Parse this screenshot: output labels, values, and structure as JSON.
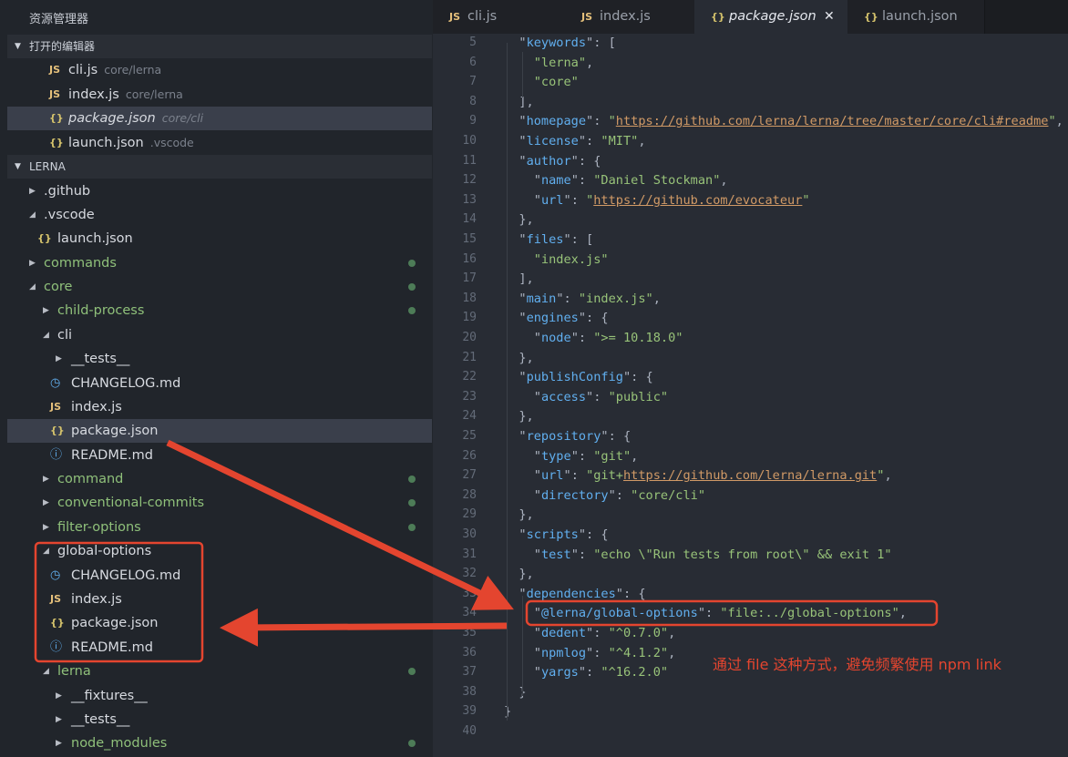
{
  "sidebar": {
    "title": "资源管理器",
    "open_editors": {
      "header": "打开的编辑器",
      "items": [
        {
          "icon": "js-file-icon",
          "icon_text": "JS",
          "name": "cli.js",
          "path": "core/lerna"
        },
        {
          "icon": "js-file-icon",
          "icon_text": "JS",
          "name": "index.js",
          "path": "core/lerna"
        },
        {
          "icon": "json-file-icon",
          "icon_text": "{}",
          "name": "package.json",
          "path": "core/cli",
          "selected": true
        },
        {
          "icon": "json-file-icon",
          "icon_text": "{}",
          "name": "launch.json",
          "path": ".vscode"
        }
      ]
    },
    "explorer": {
      "header": "LERNA",
      "tree": [
        {
          "label": ".github"
        },
        {
          "label": ".vscode"
        },
        {
          "label": "launch.json"
        },
        {
          "label": "commands"
        },
        {
          "label": "core"
        },
        {
          "label": "child-process"
        },
        {
          "label": "cli"
        },
        {
          "label": "__tests__"
        },
        {
          "label": "CHANGELOG.md"
        },
        {
          "label": "index.js"
        },
        {
          "label": "package.json"
        },
        {
          "label": "README.md"
        },
        {
          "label": "command"
        },
        {
          "label": "conventional-commits"
        },
        {
          "label": "filter-options"
        },
        {
          "label": "global-options"
        },
        {
          "label": "CHANGELOG.md"
        },
        {
          "label": "index.js"
        },
        {
          "label": "package.json"
        },
        {
          "label": "README.md"
        },
        {
          "label": "lerna"
        },
        {
          "label": "__fixtures__"
        },
        {
          "label": "__tests__"
        },
        {
          "label": "node_modules"
        }
      ]
    }
  },
  "tabs": [
    {
      "label": "cli.js",
      "icon_text": "JS"
    },
    {
      "label": "index.js",
      "icon_text": "JS"
    },
    {
      "label": "package.json",
      "icon_text": "{}",
      "active": true,
      "close": "✕"
    },
    {
      "label": "launch.json",
      "icon_text": "{}"
    }
  ],
  "editor": {
    "line_numbers": [
      "5",
      "6",
      "7",
      "8",
      "9",
      "10",
      "11",
      "12",
      "13",
      "14",
      "15",
      "16",
      "17",
      "18",
      "19",
      "20",
      "21",
      "22",
      "23",
      "24",
      "25",
      "26",
      "27",
      "28",
      "29",
      "30",
      "31",
      "32",
      "33",
      "34",
      "35",
      "36",
      "37",
      "38",
      "39",
      "40"
    ],
    "lines": [
      "  \"keywords\": [",
      "    \"lerna\",",
      "    \"core\"",
      "  ],",
      "  \"homepage\": \"https://github.com/lerna/lerna/tree/master/core/cli#readme\",",
      "  \"license\": \"MIT\",",
      "  \"author\": {",
      "    \"name\": \"Daniel Stockman\",",
      "    \"url\": \"https://github.com/evocateur\"",
      "  },",
      "  \"files\": [",
      "    \"index.js\"",
      "  ],",
      "  \"main\": \"index.js\",",
      "  \"engines\": {",
      "    \"node\": \">= 10.18.0\"",
      "  },",
      "  \"publishConfig\": {",
      "    \"access\": \"public\"",
      "  },",
      "  \"repository\": {",
      "    \"type\": \"git\",",
      "    \"url\": \"git+https://github.com/lerna/lerna.git\",",
      "    \"directory\": \"core/cli\"",
      "  },",
      "  \"scripts\": {",
      "    \"test\": \"echo \\\"Run tests from root\\\" && exit 1\"",
      "  },",
      "  \"dependencies\": {",
      "    \"@lerna/global-options\": \"file:../global-options\",",
      "    \"dedent\": \"^0.7.0\",",
      "    \"npmlog\": \"^4.1.2\",",
      "    \"yargs\": \"^16.2.0\"",
      "  }",
      "}",
      ""
    ]
  },
  "annotation": {
    "note": "通过 file 这种方式，避免频繁使用 npm link",
    "color": "#e4452f"
  }
}
